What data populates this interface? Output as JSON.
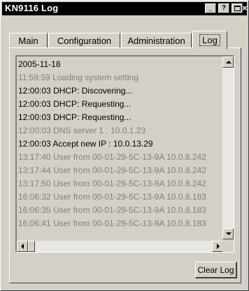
{
  "window": {
    "title": "KN9116 Log",
    "buttons": {
      "minimize": "_",
      "help": "?",
      "restore": "",
      "close": "×"
    }
  },
  "tabs": [
    {
      "label": "Main"
    },
    {
      "label": "Configuration"
    },
    {
      "label": "Administration"
    },
    {
      "label": "Log",
      "selected": true
    }
  ],
  "log": {
    "lines": [
      {
        "time": "",
        "text": "2005-11-18",
        "style": "dark"
      },
      {
        "time": "11:59:59",
        "text": "Loading system setting",
        "style": "dim"
      },
      {
        "time": "12:00:03",
        "text": "DHCP: Discovering...",
        "style": "dark"
      },
      {
        "time": "12:00:03",
        "text": "DHCP: Requesting...",
        "style": "dark"
      },
      {
        "time": "12:00:03",
        "text": "DHCP: Requesting...",
        "style": "dark"
      },
      {
        "time": "12:00:03",
        "text": "DNS server 1 : 10.0.1.23",
        "style": "dim"
      },
      {
        "time": "12:00:03",
        "text": "Accept new IP : 10.0.13.29",
        "style": "dark"
      },
      {
        "time": "13:17:40",
        "text": "User from 00-01-29-5C-13-9A 10.0.8.242",
        "style": "dim"
      },
      {
        "time": "13:17:44",
        "text": "User from 00-01-29-5C-13-9A 10.0.8.242",
        "style": "dim"
      },
      {
        "time": "13:17:50",
        "text": "User from 00-01-29-5C-13-9A 10.0.8.242",
        "style": "dim"
      },
      {
        "time": "16:06:32",
        "text": "User from 00-01-29-5C-13-9A 10.0.8.183",
        "style": "dim"
      },
      {
        "time": "16:06:35",
        "text": "User from 00-01-29-5C-13-9A 10.0.8.183",
        "style": "dim"
      },
      {
        "time": "16:06:41",
        "text": "User from 00-01-29-5C-13-9A 10.0.8.183",
        "style": "dim"
      }
    ]
  },
  "actions": {
    "clear_log": "Clear Log"
  },
  "colors": {
    "titlebar": "#000000",
    "face": "#d4d0c8",
    "dim_text": "#808080"
  }
}
